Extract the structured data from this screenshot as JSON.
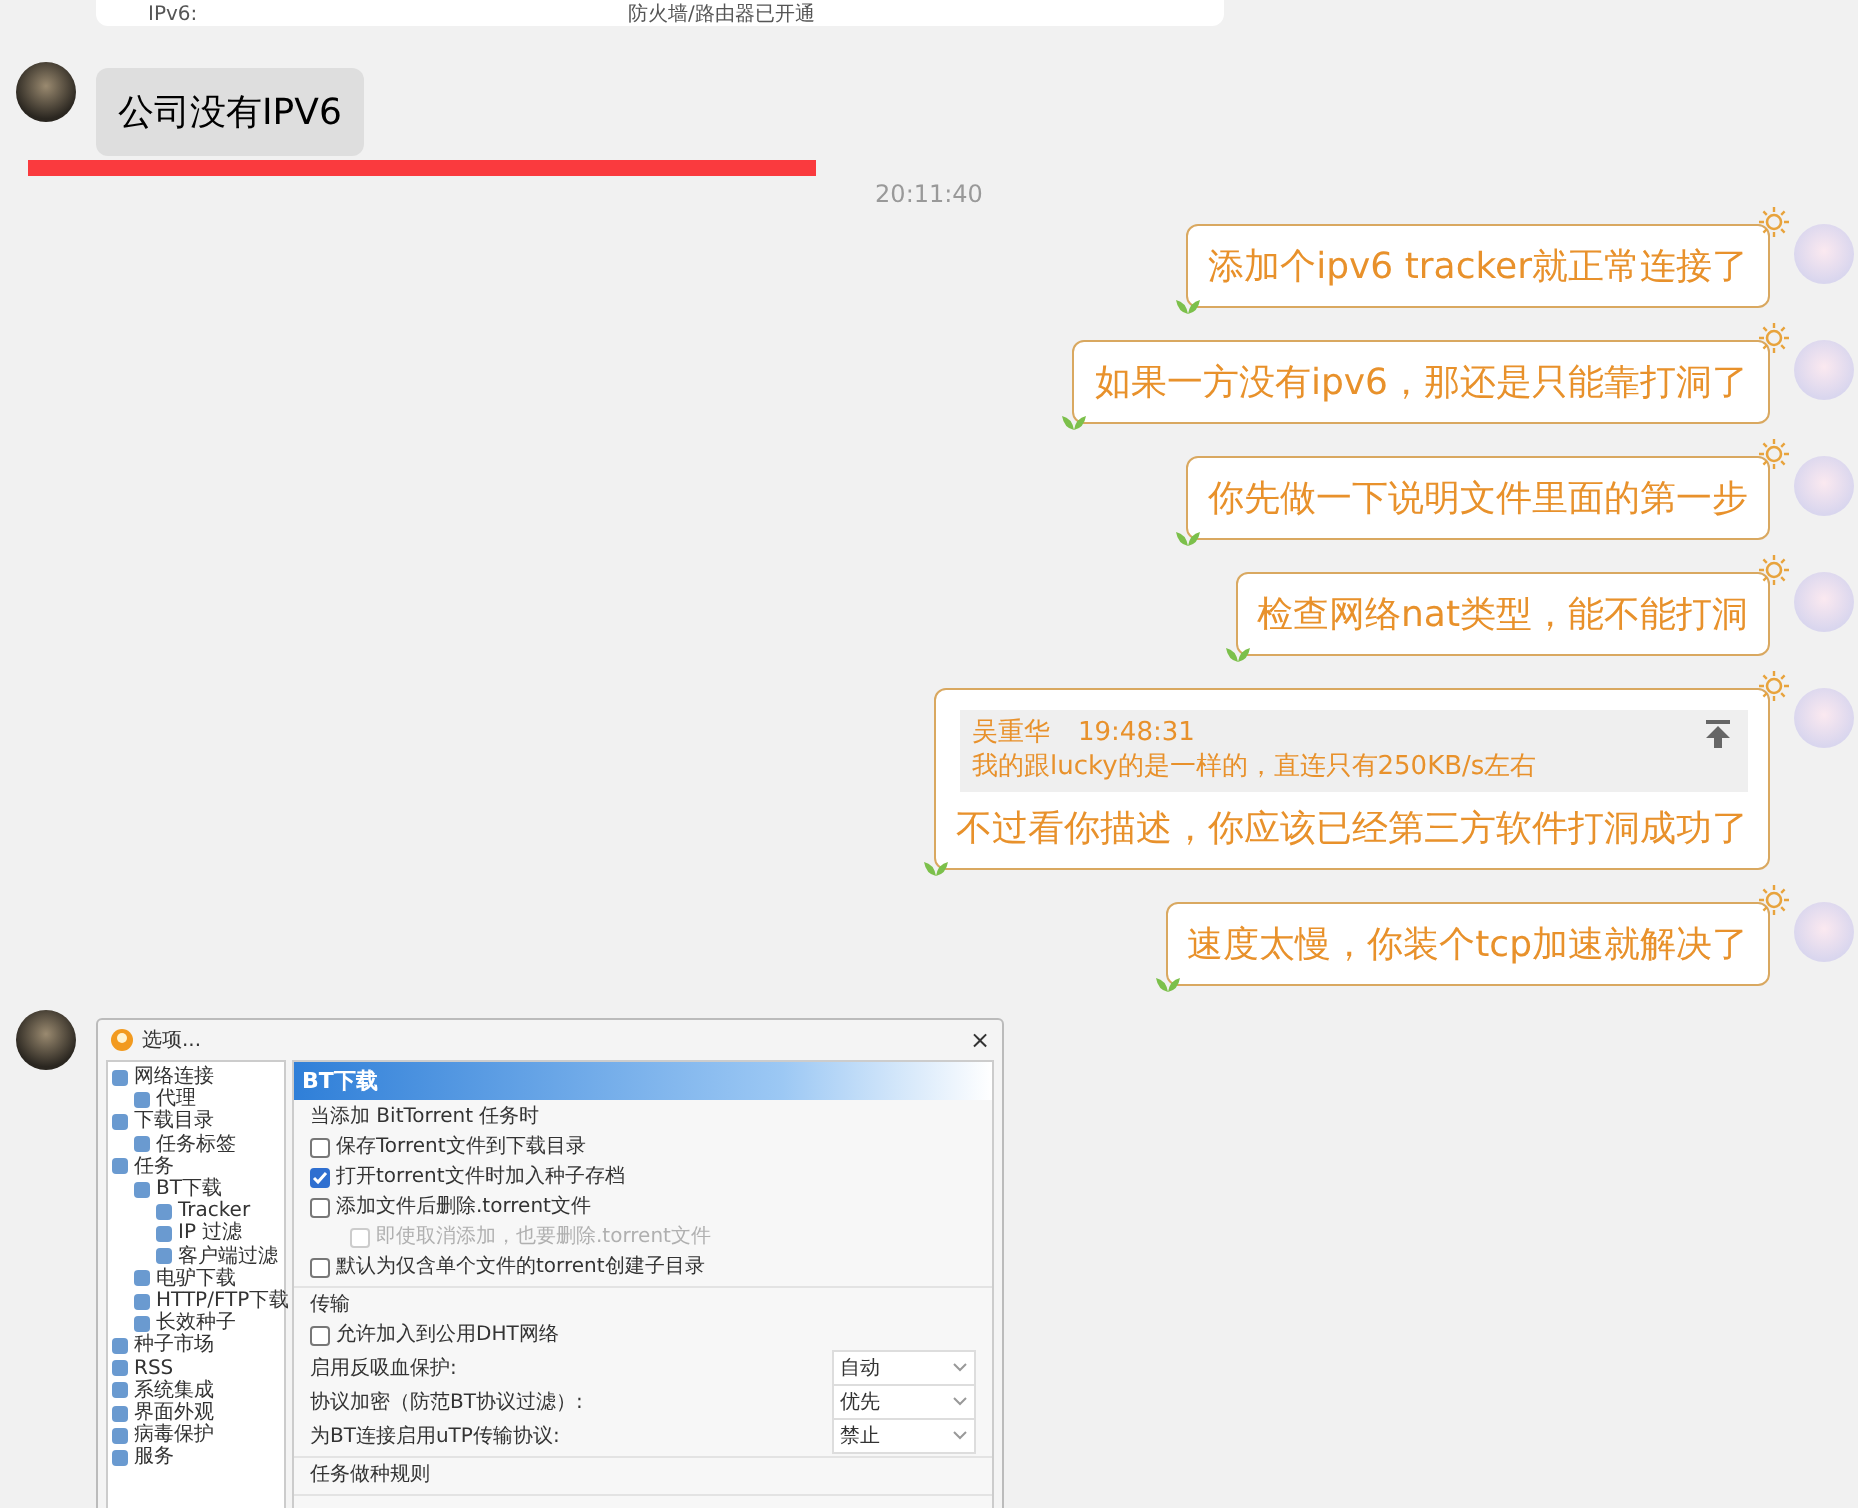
{
  "top_card": {
    "label": "IPv6:",
    "value": "防火墙/路由器已开通"
  },
  "messages": [
    {
      "kind": "incoming_text",
      "text": "公司没有IPV6",
      "highlighted": true
    },
    {
      "kind": "timestamp",
      "text": "20:11:40"
    },
    {
      "kind": "outgoing_text",
      "text": "添加个ipv6 tracker就正常连接了"
    },
    {
      "kind": "outgoing_text",
      "text": "如果一方没有ipv6，那还是只能靠打洞了"
    },
    {
      "kind": "outgoing_text",
      "text": "你先做一下说明文件里面的第一步"
    },
    {
      "kind": "outgoing_text",
      "text": "检查网络nat类型，能不能打洞"
    },
    {
      "kind": "outgoing_quote",
      "quote_author": "吴重华",
      "quote_time": "19:48:31",
      "quote_text": "我的跟lucky的是一样的，直连只有250KB/s左右",
      "text": "不过看你描述，你应该已经第三方软件打洞成功了"
    },
    {
      "kind": "outgoing_text",
      "text": "速度太慢，你装个tcp加速就解决了"
    },
    {
      "kind": "incoming_window",
      "window": {
        "title": "选项...",
        "close": "×",
        "tree": [
          {
            "label": "网络连接",
            "children": [
              {
                "label": "代理"
              }
            ]
          },
          {
            "label": "下载目录",
            "children": [
              {
                "label": "任务标签"
              }
            ]
          },
          {
            "label": "任务",
            "children": [
              {
                "label": "BT下载",
                "children": [
                  {
                    "label": "Tracker"
                  },
                  {
                    "label": "IP 过滤"
                  },
                  {
                    "label": "客户端过滤"
                  }
                ]
              },
              {
                "label": "电驴下载"
              },
              {
                "label": "HTTP/FTP下载"
              },
              {
                "label": "长效种子"
              }
            ]
          },
          {
            "label": "种子市场"
          },
          {
            "label": "RSS"
          },
          {
            "label": "系统集成"
          },
          {
            "label": "界面外观"
          },
          {
            "label": "病毒保护"
          },
          {
            "label": "服务"
          }
        ],
        "panel_title": "BT下载",
        "sections": [
          {
            "title": "当添加 BitTorrent 任务时",
            "items": [
              {
                "kind": "checkbox",
                "label": "保存Torrent文件到下载目录",
                "checked": false,
                "disabled": false,
                "indented": false
              },
              {
                "kind": "checkbox",
                "label": "打开torrent文件时加入种子存档",
                "checked": true,
                "disabled": false,
                "indented": false
              },
              {
                "kind": "checkbox",
                "label": "添加文件后删除.torrent文件",
                "checked": false,
                "disabled": false,
                "indented": false
              },
              {
                "kind": "checkbox",
                "label": "即使取消添加，也要删除.torrent文件",
                "checked": false,
                "disabled": true,
                "indented": true
              },
              {
                "kind": "checkbox",
                "label": "默认为仅含单个文件的torrent创建子目录",
                "checked": false,
                "disabled": false,
                "indented": false
              }
            ]
          },
          {
            "title": "传输",
            "items": [
              {
                "kind": "checkbox",
                "label": "允许加入到公用DHT网络",
                "checked": false,
                "disabled": false,
                "indented": false
              },
              {
                "kind": "select",
                "label": "启用反吸血保护:",
                "value": "自动"
              },
              {
                "kind": "select",
                "label": "协议加密（防范BT协议过滤）:",
                "value": "优先"
              },
              {
                "kind": "select",
                "label": "为BT连接启用uTP传输协议:",
                "value": "禁止"
              }
            ]
          },
          {
            "title": "任务做种规则"
          }
        ]
      }
    }
  ]
}
